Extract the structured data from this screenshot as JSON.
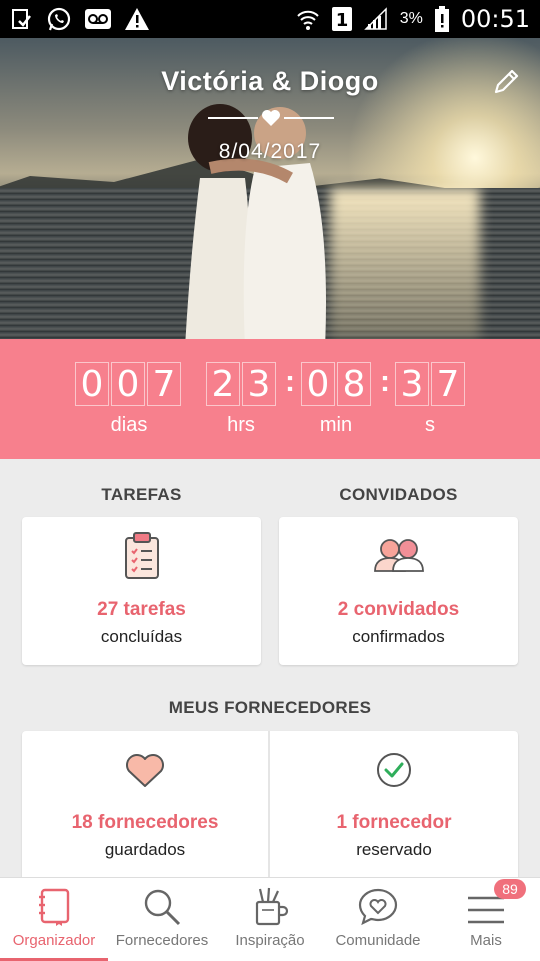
{
  "status_bar": {
    "battery": "3%",
    "time": "00:51",
    "sim": "1"
  },
  "hero": {
    "title": "Victória & Diogo",
    "date": "8/04/2017"
  },
  "countdown": {
    "days": [
      "0",
      "0",
      "7"
    ],
    "hours": [
      "2",
      "3"
    ],
    "minutes": [
      "0",
      "8"
    ],
    "seconds": [
      "3",
      "7"
    ],
    "separator": ":",
    "labels": {
      "days": "dias",
      "hours": "hrs",
      "minutes": "min",
      "seconds": "s"
    }
  },
  "tasks": {
    "heading": "TAREFAS",
    "count": "27 tarefas",
    "status": "concluídas"
  },
  "guests": {
    "heading": "CONVIDADOS",
    "count": "2 convidados",
    "status": "confirmados"
  },
  "vendors": {
    "heading": "MEUS FORNECEDORES",
    "saved_count": "18 fornecedores",
    "saved_status": "guardados",
    "booked_count": "1 fornecedor",
    "booked_status": "reservado"
  },
  "bottom_nav": {
    "items": [
      {
        "label": "Organizador",
        "icon": "notebook-icon",
        "active": true
      },
      {
        "label": "Fornecedores",
        "icon": "search-icon"
      },
      {
        "label": "Inspiração",
        "icon": "cup-pencils-icon"
      },
      {
        "label": "Comunidade",
        "icon": "chat-heart-icon"
      },
      {
        "label": "Mais",
        "icon": "menu-icon"
      }
    ],
    "badge": "89"
  },
  "colors": {
    "accent": "#e8646f",
    "countdown_bg": "#f7808d",
    "background": "#ececec"
  }
}
